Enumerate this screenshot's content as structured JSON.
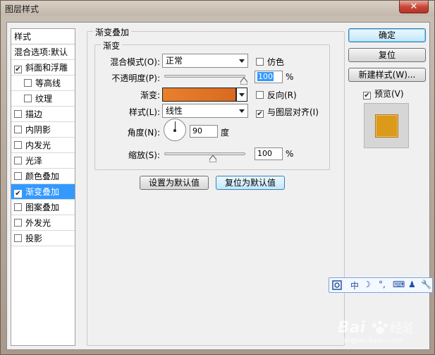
{
  "window": {
    "title": "图层样式",
    "close_glyph": "✕"
  },
  "sidebar": {
    "header": "样式",
    "blend_options": "混合选项:默认",
    "items": [
      {
        "label": "斜面和浮雕",
        "checked": true,
        "sub": false
      },
      {
        "label": "等高线",
        "checked": false,
        "sub": true
      },
      {
        "label": "纹理",
        "checked": false,
        "sub": true
      },
      {
        "label": "描边",
        "checked": false,
        "sub": false
      },
      {
        "label": "内阴影",
        "checked": false,
        "sub": false
      },
      {
        "label": "内发光",
        "checked": false,
        "sub": false
      },
      {
        "label": "光泽",
        "checked": false,
        "sub": false
      },
      {
        "label": "颜色叠加",
        "checked": false,
        "sub": false
      },
      {
        "label": "渐变叠加",
        "checked": true,
        "sub": false,
        "selected": true
      },
      {
        "label": "图案叠加",
        "checked": false,
        "sub": false
      },
      {
        "label": "外发光",
        "checked": false,
        "sub": false
      },
      {
        "label": "投影",
        "checked": false,
        "sub": false
      }
    ]
  },
  "panel": {
    "outer_title": "渐变叠加",
    "inner_title": "渐变",
    "blend_mode_label": "混合模式(O):",
    "blend_mode_value": "正常",
    "dither_label": "仿色",
    "opacity_label": "不透明度(P):",
    "opacity_value": "100",
    "opacity_unit": "%",
    "opacity_level": 1.0,
    "gradient_label": "渐变:",
    "reverse_label": "反向(R)",
    "style_label": "样式(L):",
    "style_value": "线性",
    "align_label": "与图层对齐(I)",
    "angle_label": "角度(N):",
    "angle_value": "90",
    "angle_unit": "度",
    "scale_label": "缩放(S):",
    "scale_value": "100",
    "scale_unit": "%",
    "scale_level": 0.5,
    "set_default_button": "设置为默认值",
    "reset_default_button": "复位为默认值",
    "checks": {
      "dither": false,
      "reverse": false,
      "align": true
    }
  },
  "right": {
    "ok_button": "确定",
    "reset_button": "复位",
    "new_style_button": "新建样式(W)...",
    "preview_label": "预览(V)",
    "preview_checked": true,
    "preview_color": "#dc9a1a"
  },
  "ime": {
    "items": [
      "中",
      "☽",
      "°,",
      "⌨",
      "♟",
      "🔧"
    ]
  },
  "colors": {
    "gradient_start": "#e8802e",
    "gradient_end": "#d96a20",
    "selection": "#3399ff"
  }
}
